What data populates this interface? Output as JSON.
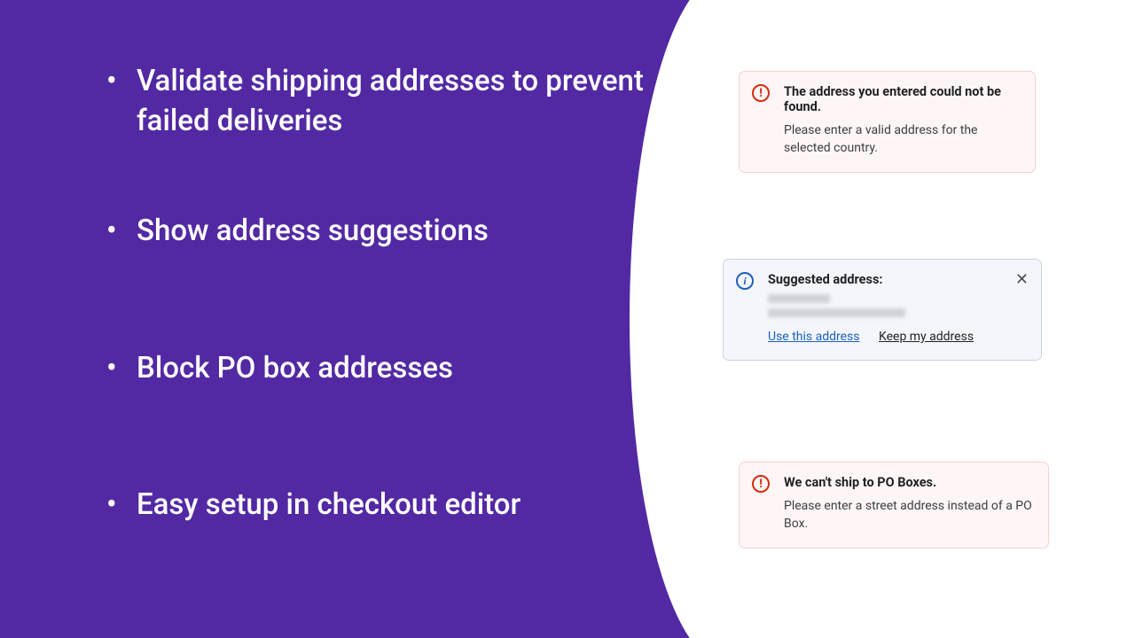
{
  "features": {
    "b0": "Validate shipping addresses to prevent failed deliveries",
    "b1": "Show address suggestions",
    "b2": "Block PO box addresses",
    "b3": "Easy setup in checkout editor"
  },
  "error_not_found": {
    "title": "The address you entered could not be found.",
    "body": "Please enter a valid address for the selected country."
  },
  "suggestion": {
    "title": "Suggested address:",
    "use": "Use this address",
    "keep": "Keep my address"
  },
  "error_pobox": {
    "title": "We can't ship to PO Boxes.",
    "body": "Please enter a street address instead of a PO Box."
  }
}
